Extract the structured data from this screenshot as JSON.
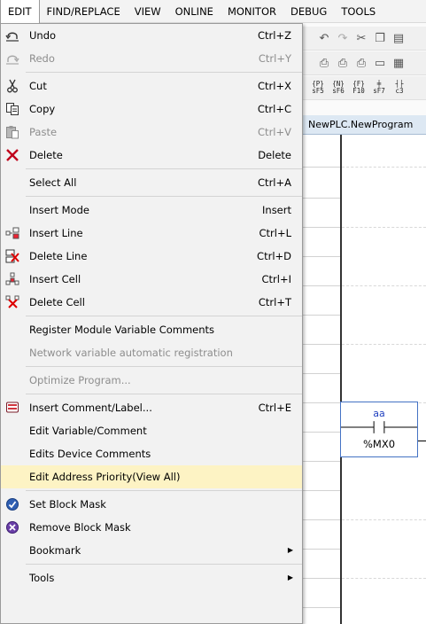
{
  "menubar": {
    "items": [
      "EDIT",
      "FIND/REPLACE",
      "VIEW",
      "ONLINE",
      "MONITOR",
      "DEBUG",
      "TOOLS"
    ]
  },
  "toolbar": {
    "function_keys": [
      {
        "top": "{P}",
        "bottom": "sF5"
      },
      {
        "top": "{N}",
        "bottom": "sF6"
      },
      {
        "top": "{F}",
        "bottom": "F10"
      },
      {
        "top": "╪",
        "bottom": "sF7"
      },
      {
        "top": "┤├",
        "bottom": "c3"
      }
    ]
  },
  "editor": {
    "tab_title": "NewPLC.NewProgram",
    "contact": {
      "name": "aa",
      "address": "%MX0"
    }
  },
  "edit_menu": {
    "groups": [
      [
        {
          "label": "Undo",
          "shortcut": "Ctrl+Z",
          "icon": "undo-icon",
          "disabled": false
        },
        {
          "label": "Redo",
          "shortcut": "Ctrl+Y",
          "icon": "redo-icon",
          "disabled": true
        }
      ],
      [
        {
          "label": "Cut",
          "shortcut": "Ctrl+X",
          "icon": "scissors-icon",
          "disabled": false
        },
        {
          "label": "Copy",
          "shortcut": "Ctrl+C",
          "icon": "copy-icon",
          "disabled": false
        },
        {
          "label": "Paste",
          "shortcut": "Ctrl+V",
          "icon": "paste-icon",
          "disabled": true
        },
        {
          "label": "Delete",
          "shortcut": "Delete",
          "icon": "delete-x-icon",
          "disabled": false
        }
      ],
      [
        {
          "label": "Select All",
          "shortcut": "Ctrl+A",
          "icon": "",
          "disabled": false
        }
      ],
      [
        {
          "label": "Insert Mode",
          "shortcut": "Insert",
          "icon": "",
          "disabled": false
        },
        {
          "label": "Insert Line",
          "shortcut": "Ctrl+L",
          "icon": "insert-line-icon",
          "disabled": false
        },
        {
          "label": "Delete Line",
          "shortcut": "Ctrl+D",
          "icon": "delete-line-icon",
          "disabled": false
        },
        {
          "label": "Insert Cell",
          "shortcut": "Ctrl+I",
          "icon": "insert-cell-icon",
          "disabled": false
        },
        {
          "label": "Delete Cell",
          "shortcut": "Ctrl+T",
          "icon": "delete-cell-icon",
          "disabled": false
        }
      ],
      [
        {
          "label": "Register Module Variable Comments",
          "shortcut": "",
          "icon": "",
          "disabled": false
        },
        {
          "label": "Network variable automatic registration",
          "shortcut": "",
          "icon": "",
          "disabled": true
        }
      ],
      [
        {
          "label": "Optimize Program...",
          "shortcut": "",
          "icon": "",
          "disabled": true
        }
      ],
      [
        {
          "label": "Insert Comment/Label...",
          "shortcut": "Ctrl+E",
          "icon": "comment-icon",
          "disabled": false
        },
        {
          "label": "Edit Variable/Comment",
          "shortcut": "",
          "icon": "",
          "disabled": false
        },
        {
          "label": "Edits Device Comments",
          "shortcut": "",
          "icon": "",
          "disabled": false
        },
        {
          "label": "Edit Address Priority(View All)",
          "shortcut": "",
          "icon": "",
          "disabled": false,
          "highlighted": true
        }
      ],
      [
        {
          "label": "Set Block Mask",
          "shortcut": "",
          "icon": "set-block-mask-icon",
          "disabled": false
        },
        {
          "label": "Remove Block Mask",
          "shortcut": "",
          "icon": "remove-block-mask-icon",
          "disabled": false
        },
        {
          "label": "Bookmark",
          "shortcut": "",
          "icon": "",
          "disabled": false,
          "submenu": true
        }
      ],
      [
        {
          "label": "Tools",
          "shortcut": "",
          "icon": "",
          "disabled": false,
          "submenu": true
        }
      ]
    ]
  }
}
